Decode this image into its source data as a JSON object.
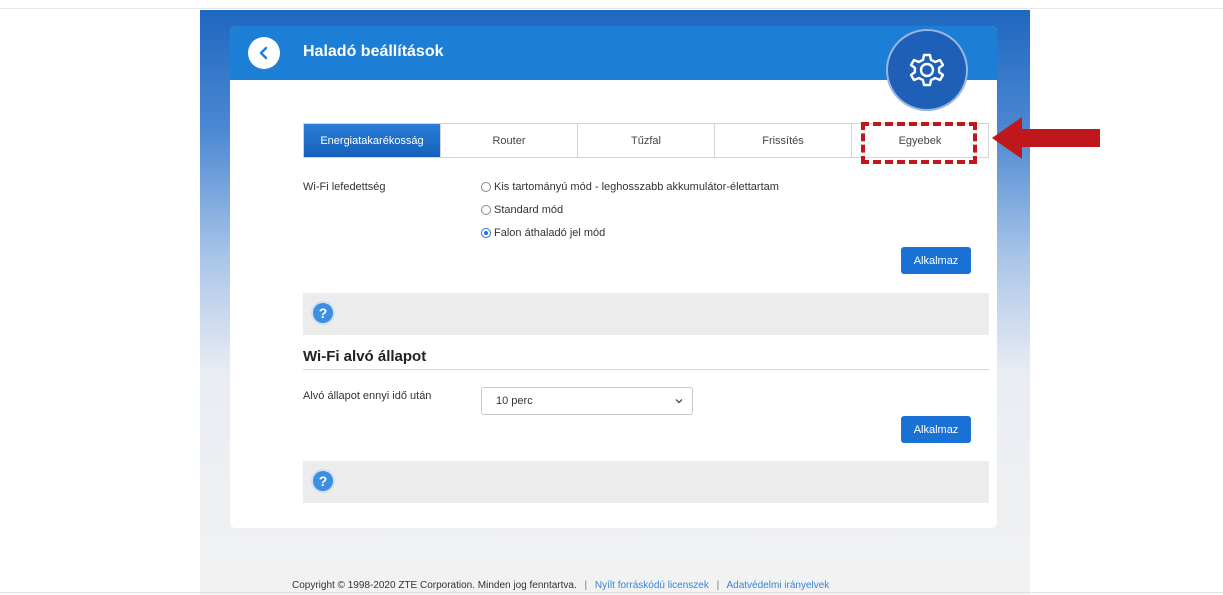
{
  "header": {
    "title": "Haladó beállítások"
  },
  "tabs": [
    {
      "label": "Energiatakarékosság",
      "active": true
    },
    {
      "label": "Router",
      "active": false
    },
    {
      "label": "Tűzfal",
      "active": false
    },
    {
      "label": "Frissítés",
      "active": false
    },
    {
      "label": "Egyebek",
      "active": false
    }
  ],
  "wifi_coverage": {
    "label": "Wi-Fi lefedettség",
    "options": [
      {
        "label": "Kis tartományú mód - leghosszabb akkumulátor-élettartam",
        "checked": false
      },
      {
        "label": "Standard mód",
        "checked": false
      },
      {
        "label": "Falon áthaladó jel mód",
        "checked": true
      }
    ],
    "apply_label": "Alkalmaz"
  },
  "wifi_sleep": {
    "title": "Wi-Fi alvó állapot",
    "label": "Alvó állapot ennyi idő után",
    "selected": "10 perc",
    "apply_label": "Alkalmaz"
  },
  "help": {
    "glyph": "?"
  },
  "footer": {
    "copyright": "Copyright © 1998-2020 ZTE Corporation. Minden jog fenntartva.",
    "sep": "|",
    "link_licenses": "Nyílt forráskódú licenszek",
    "link_privacy": "Adatvédelmi irányelvek"
  },
  "icons": {
    "back": "chevron-left-icon",
    "gear": "gear-icon",
    "help": "help-icon",
    "dropdown": "chevron-down-icon",
    "annotation_arrow": "arrow-left-icon"
  },
  "colors": {
    "primary": "#1d7ed6",
    "active_tab": "#1560bb",
    "annotation": "#c0171c"
  }
}
